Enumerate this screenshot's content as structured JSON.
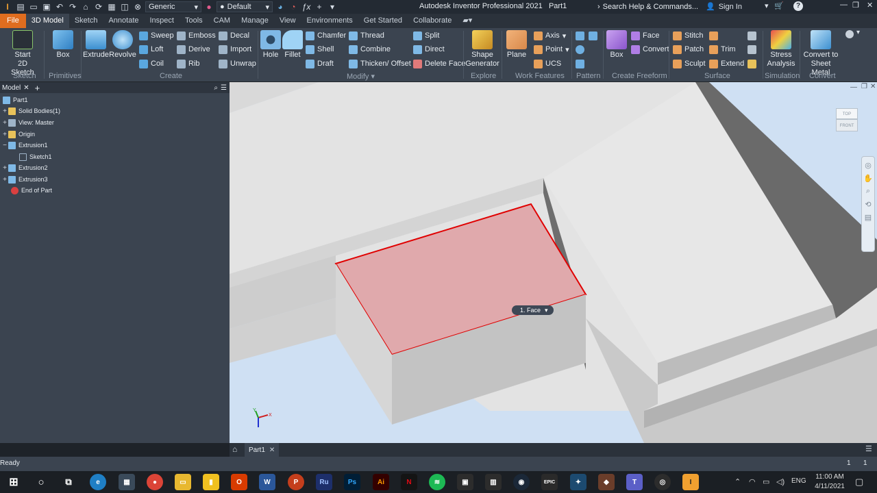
{
  "titlebar": {
    "app_title": "Autodesk Inventor Professional 2021",
    "doc_name": "Part1",
    "appearance": "Generic",
    "material": "Default",
    "search": "Search Help & Commands...",
    "sign_in": "Sign In"
  },
  "tabs": [
    "File",
    "3D Model",
    "Sketch",
    "Annotate",
    "Inspect",
    "Tools",
    "CAM",
    "Manage",
    "View",
    "Environments",
    "Get Started",
    "Collaborate"
  ],
  "ribbon": {
    "sketch": {
      "start": "Start",
      "sketch2d": "2D Sketch",
      "panel": "Sketch"
    },
    "primitives": {
      "box": "Box",
      "panel": "Primitives"
    },
    "create": {
      "extrude": "Extrude",
      "revolve": "Revolve",
      "sweep": "Sweep",
      "loft": "Loft",
      "coil": "Coil",
      "emboss": "Emboss",
      "derive": "Derive",
      "rib": "Rib",
      "decal": "Decal",
      "import": "Import",
      "unwrap": "Unwrap",
      "panel": "Create"
    },
    "modify": {
      "hole": "Hole",
      "fillet": "Fillet",
      "chamfer": "Chamfer",
      "shell": "Shell",
      "draft": "Draft",
      "thread": "Thread",
      "combine": "Combine",
      "thicken": "Thicken/ Offset",
      "split": "Split",
      "direct": "Direct",
      "delete_face": "Delete Face",
      "panel": "Modify"
    },
    "explore": {
      "shape": "Shape",
      "generator": "Generator",
      "panel": "Explore"
    },
    "work_features": {
      "plane": "Plane",
      "axis": "Axis",
      "point": "Point",
      "ucs": "UCS",
      "panel": "Work Features"
    },
    "pattern": {
      "panel": "Pattern"
    },
    "freeform": {
      "box": "Box",
      "face": "Face",
      "convert": "Convert",
      "panel": "Create Freeform"
    },
    "surface": {
      "stitch": "Stitch",
      "patch": "Patch",
      "sculpt": "Sculpt",
      "trim": "Trim",
      "extend": "Extend",
      "panel": "Surface"
    },
    "simulation": {
      "stress": "Stress",
      "analysis": "Analysis",
      "panel": "Simulation"
    },
    "convert": {
      "to": "Convert to",
      "sheet": "Sheet Metal",
      "panel": "Convert"
    }
  },
  "browser": {
    "tab": "Model",
    "tree": [
      {
        "label": "Part1",
        "icon": "part-icon"
      },
      {
        "label": "Solid Bodies(1)",
        "icon": "folder-icon"
      },
      {
        "label": "View: Master",
        "icon": "view-icon"
      },
      {
        "label": "Origin",
        "icon": "folder-icon"
      },
      {
        "label": "Extrusion1",
        "icon": "extrude-icon"
      },
      {
        "label": "Sketch1",
        "icon": "sketch-icon"
      },
      {
        "label": "Extrusion2",
        "icon": "extrude-icon"
      },
      {
        "label": "Extrusion3",
        "icon": "extrude-icon"
      },
      {
        "label": "End of Part",
        "icon": "end-of-part-icon"
      }
    ]
  },
  "viewport": {
    "tooltip": "1. Face",
    "viewcube_top": "TOP",
    "viewcube_front": "FRONT",
    "axis_x": "X",
    "axis_y": "Y",
    "colors": {
      "background": "#cfe0f3",
      "selected_face": "#e0a9ac",
      "edge_highlight": "#e00000"
    }
  },
  "doc_tab": "Part1",
  "status": {
    "text": "Ready",
    "count1": "1",
    "count2": "1"
  },
  "taskbar": {
    "lang": "ENG",
    "time": "11:00 AM",
    "date": "4/11/2021",
    "apps": [
      {
        "name": "Ru",
        "color": "#1d2f6b"
      },
      {
        "name": "Ps",
        "color": "#001e36"
      },
      {
        "name": "Ai",
        "color": "#330000"
      }
    ]
  }
}
